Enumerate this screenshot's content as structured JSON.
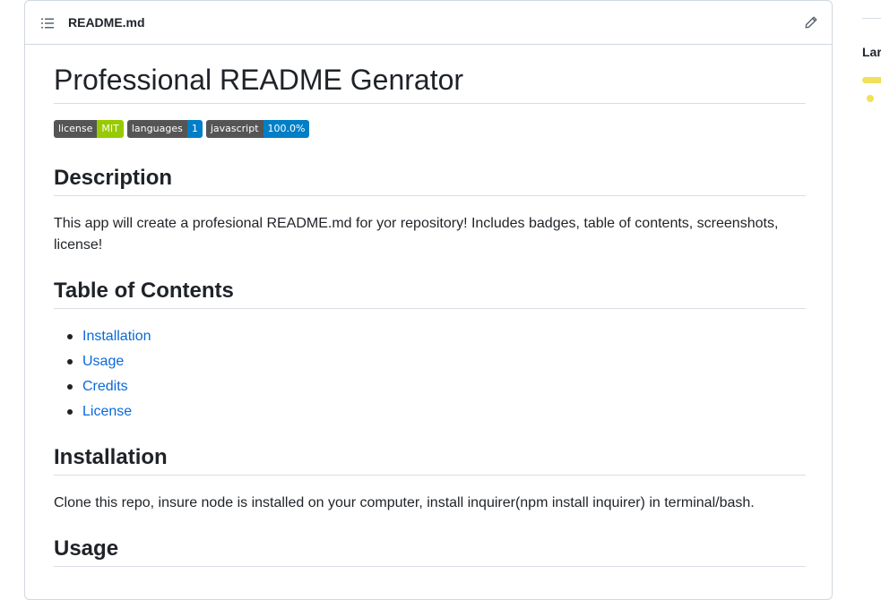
{
  "file": {
    "name": "README.md"
  },
  "readme": {
    "title": "Professional README Genrator",
    "badges": [
      {
        "label": "license",
        "value": "MIT",
        "color": "#97ca00"
      },
      {
        "label": "languages",
        "value": "1",
        "color": "#007ec6"
      },
      {
        "label": "javascript",
        "value": "100.0%",
        "color": "#007ec6"
      }
    ],
    "description": {
      "heading": "Description",
      "text": "This app will create a profesional README.md for yor repository! Includes badges, table of contents, screenshots, license!"
    },
    "toc": {
      "heading": "Table of Contents",
      "items": [
        "Installation",
        "Usage",
        "Credits",
        "License"
      ]
    },
    "installation": {
      "heading": "Installation",
      "text": "Clone this repo, insure node is installed on your computer, install inquirer(npm install inquirer) in terminal/bash."
    },
    "usage": {
      "heading": "Usage"
    }
  },
  "sidebar": {
    "heading_partial": "Lar",
    "language_color": "#f1e05a"
  },
  "icons": {
    "toc": "list-unordered-icon",
    "edit": "pencil-icon"
  }
}
